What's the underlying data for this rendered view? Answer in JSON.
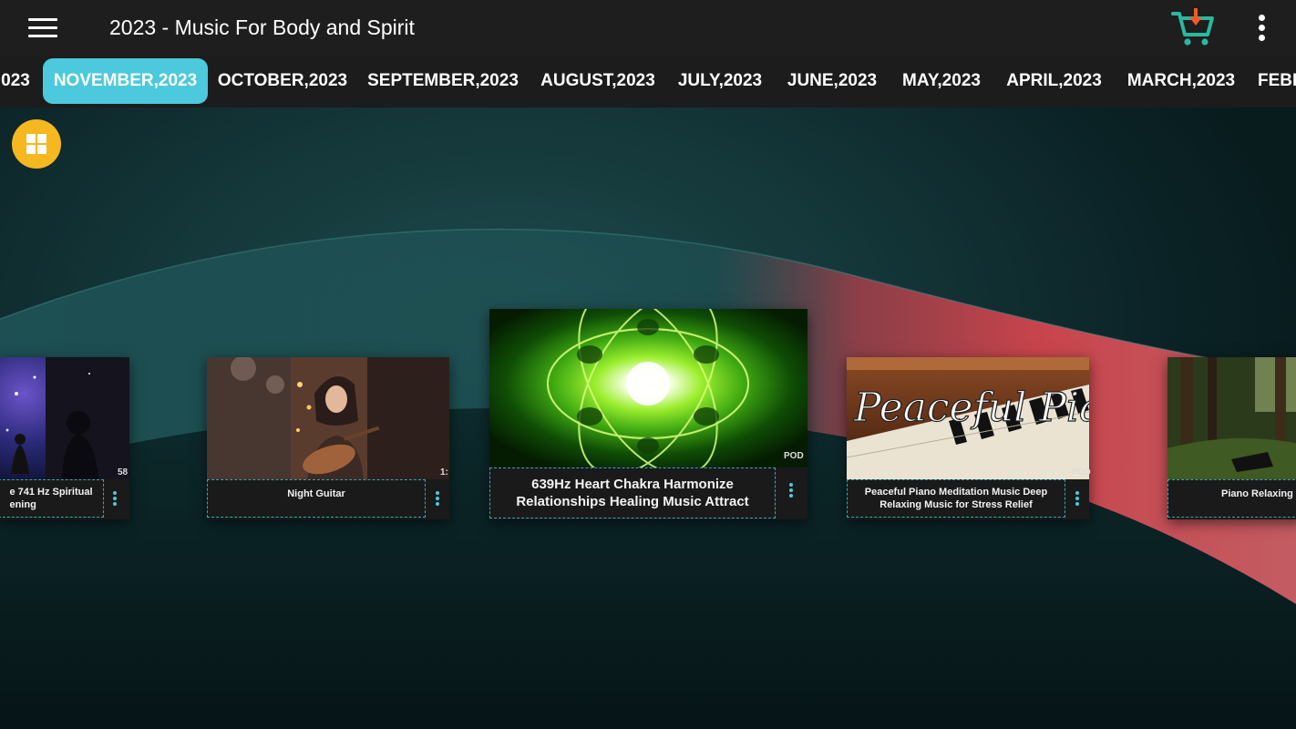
{
  "header": {
    "title": "2023 - Music For Body and Spirit",
    "icons": {
      "menu": "hamburger-menu-icon",
      "cart": "cart-download-icon",
      "more": "more-vertical-icon"
    }
  },
  "tabs": [
    {
      "label": "023"
    },
    {
      "label": "NOVEMBER,2023",
      "active": true
    },
    {
      "label": "OCTOBER,2023"
    },
    {
      "label": "SEPTEMBER,2023"
    },
    {
      "label": "AUGUST,2023"
    },
    {
      "label": "JULY,2023"
    },
    {
      "label": "JUNE,2023"
    },
    {
      "label": "MAY,2023"
    },
    {
      "label": "APRIL,2023"
    },
    {
      "label": "MARCH,2023"
    },
    {
      "label": "FEBR"
    }
  ],
  "cards": [
    {
      "title_line1": "e 741 Hz Spiritual",
      "title_line2": "ening",
      "tag": "58"
    },
    {
      "title_line1": "Night Guitar",
      "title_line2": "",
      "tag": "1:"
    },
    {
      "title_line1": "639Hz Heart Chakra  Harmonize",
      "title_line2": "Relationships  Healing Music  Attract",
      "tag": "POD"
    },
    {
      "title_line1": "Peaceful Piano  Meditation Music  Deep",
      "title_line2": "Relaxing Music for Stress Relief",
      "tag": "POD",
      "thumb_text": "Peaceful Piano"
    },
    {
      "title_line1": "Piano Relaxing",
      "title_line2": "",
      "tag": ""
    }
  ],
  "colors": {
    "accent": "#4cc9dc",
    "topbar": "#1e1e1e",
    "grid_button": "#f5b820",
    "cart_green": "#2bb7a0",
    "cart_arrow": "#f05a28"
  }
}
